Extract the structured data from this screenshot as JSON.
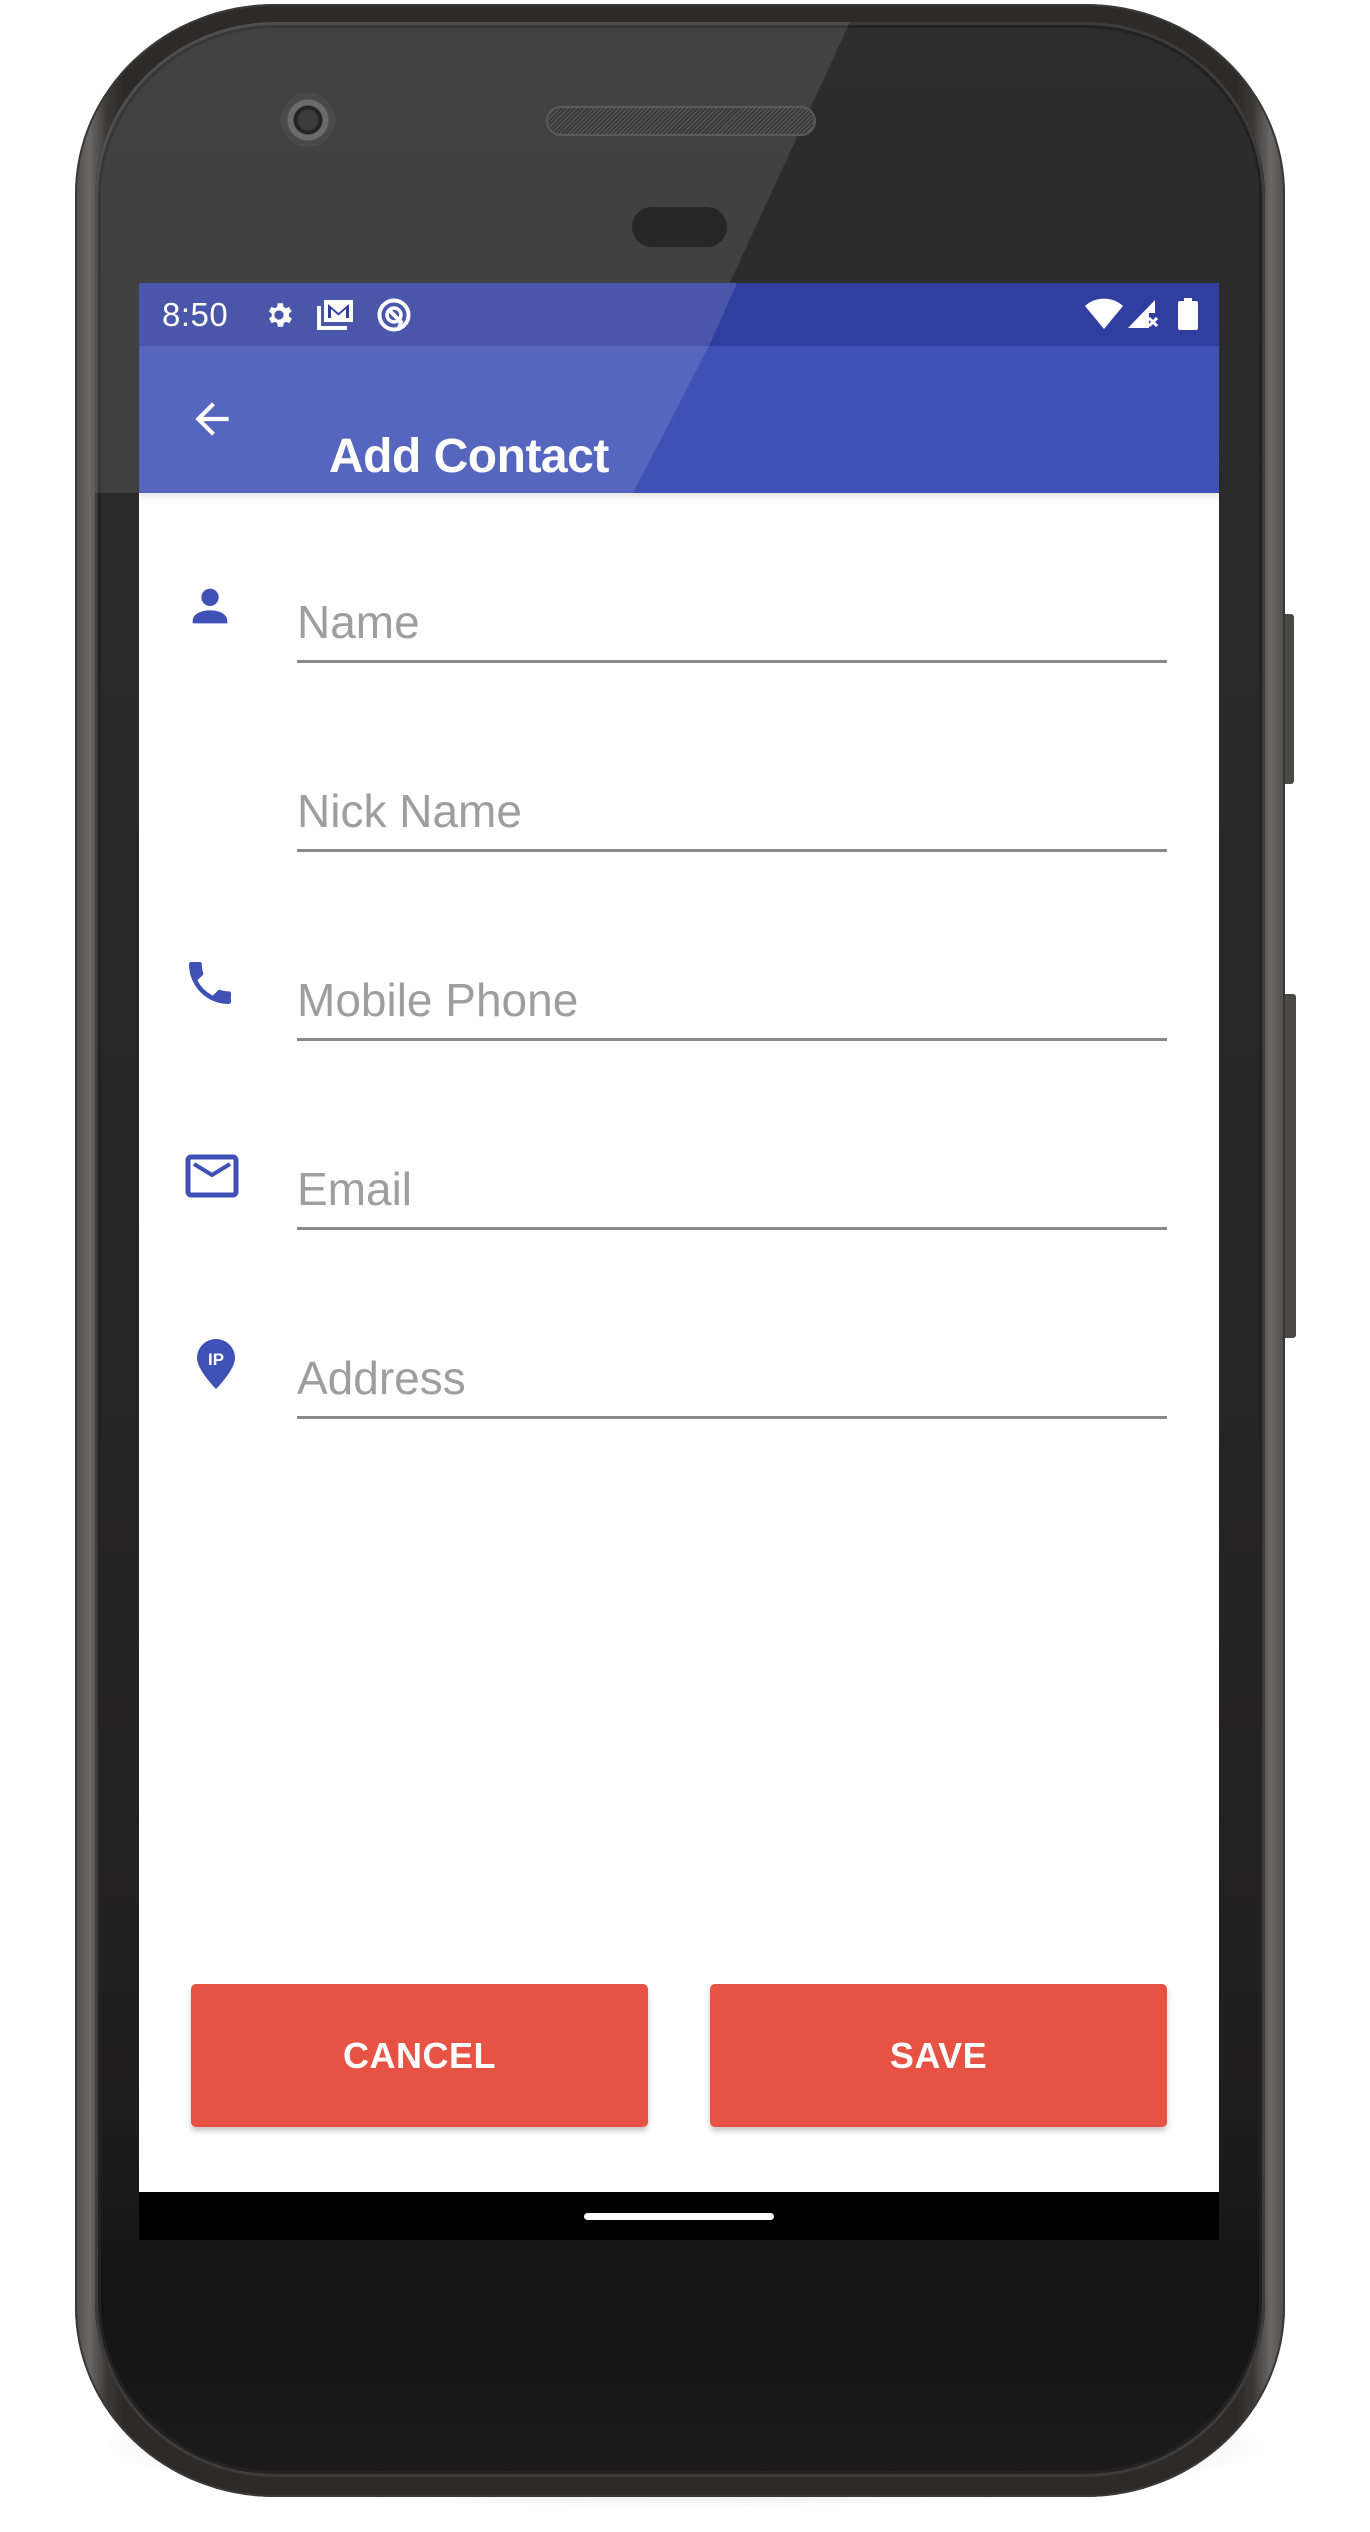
{
  "status_bar": {
    "time": "8:50",
    "left_icons": [
      "settings-gear-icon",
      "gmail-stack-icon",
      "q-badge-icon"
    ],
    "right_icons": [
      "wifi-icon",
      "cell-signal-no-sim-icon",
      "battery-full-icon"
    ]
  },
  "app_bar": {
    "back_icon": "arrow-back-icon",
    "title": "Add Contact"
  },
  "form": {
    "fields": [
      {
        "id": "name",
        "icon": "person-icon",
        "placeholder": "Name",
        "value": ""
      },
      {
        "id": "nick_name",
        "icon": "",
        "placeholder": "Nick Name",
        "value": ""
      },
      {
        "id": "mobile_phone",
        "icon": "phone-icon",
        "placeholder": "Mobile Phone",
        "value": ""
      },
      {
        "id": "email",
        "icon": "mail-icon",
        "placeholder": "Email",
        "value": ""
      },
      {
        "id": "address",
        "icon": "ip-location-pin-icon",
        "placeholder": "Address",
        "value": ""
      }
    ],
    "pin_icon_text": "IP"
  },
  "actions": {
    "cancel_label": "CANCEL",
    "save_label": "SAVE"
  },
  "colors": {
    "primary": "#3f51b5",
    "primary_dark": "#303f9f",
    "accent_button": "#e65244",
    "placeholder": "#9e9e9e",
    "underline": "#8a8a8a"
  }
}
